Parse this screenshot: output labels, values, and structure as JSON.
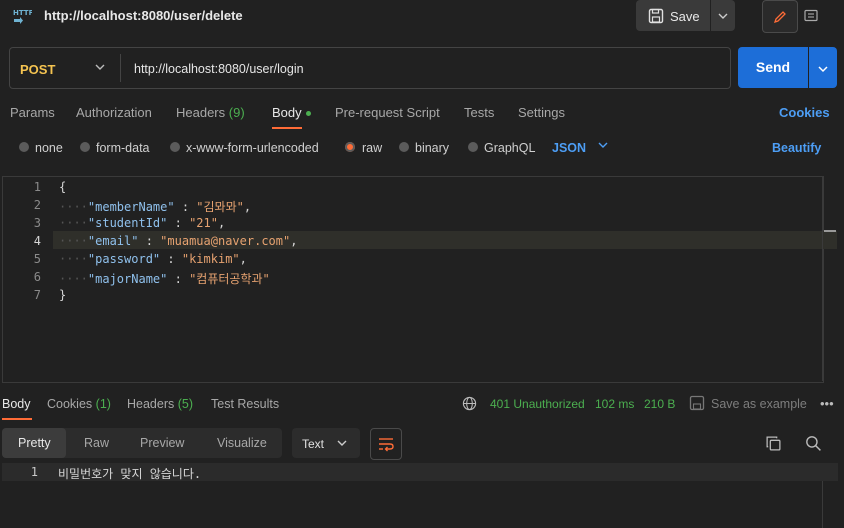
{
  "header": {
    "request_icon": "HTTP",
    "title": "http://localhost:8080/user/delete",
    "save_label": "Save"
  },
  "request": {
    "method": "POST",
    "url": "http://localhost:8080/user/login",
    "send_label": "Send"
  },
  "tabs": {
    "params": "Params",
    "authorization": "Authorization",
    "headers": "Headers",
    "headers_count": "(9)",
    "body": "Body",
    "prerequest": "Pre-request Script",
    "tests": "Tests",
    "settings": "Settings",
    "cookies": "Cookies"
  },
  "body_types": {
    "none": "none",
    "form_data": "form-data",
    "urlencoded": "x-www-form-urlencoded",
    "raw": "raw",
    "binary": "binary",
    "graphql": "GraphQL",
    "format": "JSON",
    "beautify": "Beautify",
    "selected": "raw"
  },
  "editor": {
    "current_line": 4,
    "lines": [
      {
        "num": "1"
      },
      {
        "num": "2",
        "key": "\"memberName\"",
        "sep": " : ",
        "val": "\"김뫄뫄\"",
        "end": ","
      },
      {
        "num": "3",
        "key": "\"studentId\"",
        "sep": " : ",
        "val": "\"21\"",
        "end": ","
      },
      {
        "num": "4",
        "key": "\"email\"",
        "sep": " : ",
        "val": "\"muamua@naver.com\"",
        "end": ","
      },
      {
        "num": "5",
        "key": "\"password\"",
        "sep": " : ",
        "val": "\"kimkim\"",
        "end": ","
      },
      {
        "num": "6",
        "key": "\"majorName\"",
        "sep": " : ",
        "val": "\"컴퓨터공학과\"",
        "end": ""
      },
      {
        "num": "7"
      }
    ],
    "open_brace": "{",
    "close_brace": "}"
  },
  "response": {
    "tabs": {
      "body": "Body",
      "cookies": "Cookies",
      "cookies_count": "(1)",
      "headers": "Headers",
      "headers_count": "(5)",
      "test_results": "Test Results"
    },
    "status": "401 Unauthorized",
    "time": "102 ms",
    "size": "210 B",
    "save_example": "Save as example",
    "formats": {
      "pretty": "Pretty",
      "raw": "Raw",
      "preview": "Preview",
      "visualize": "Visualize",
      "text_select": "Text"
    },
    "line_num": "1",
    "body_text": "비밀번호가 맞지 않습니다."
  },
  "colors": {
    "accent": "#ff6c37",
    "link": "#4d9ef5",
    "send": "#1d6ed8",
    "status_ok": "#4caf50",
    "method": "#f5c451"
  }
}
